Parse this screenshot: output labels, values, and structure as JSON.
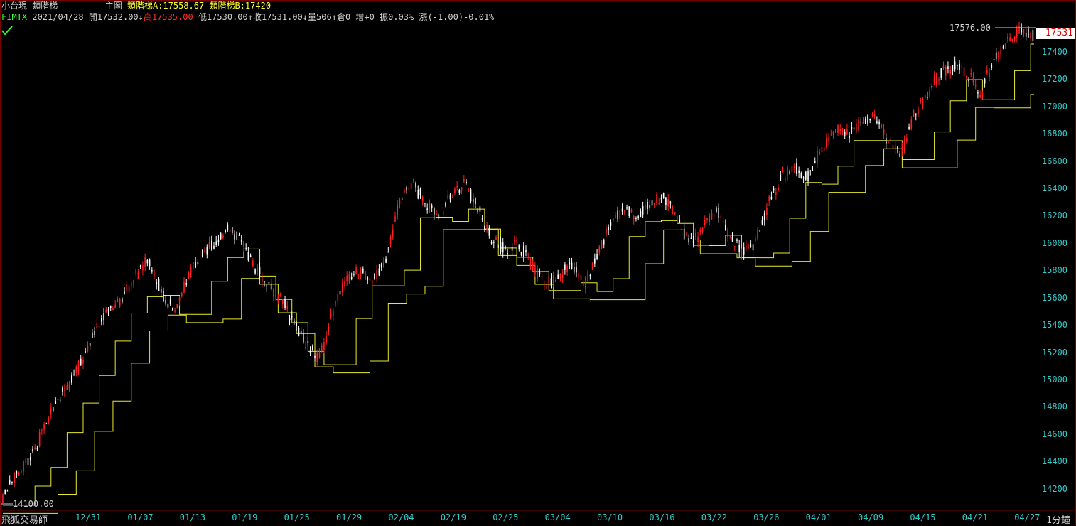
{
  "header": {
    "instrument_name": "小台現",
    "indicator_name": "類階梯",
    "main_chart_label": "主圖",
    "ladder_a": "類階梯A:17558.67",
    "ladder_b": "類階梯B:17420"
  },
  "quote": {
    "symbol": "FIMTX",
    "date": "2021/04/28",
    "open": "開17532.00",
    "high_arrow": "↓",
    "high": "高17535.00",
    "low": "低17530.00",
    "close_arrow": "↑",
    "close": "收17531.00",
    "volume_arrow": "↓",
    "volume": "量506",
    "oi_arrow": "↑",
    "open_interest": "倉0",
    "oi_change": "增+0",
    "amplitude": "振0.03%",
    "change": "漲(-1.00)-0.01%"
  },
  "chart_labels": {
    "high_marker": "17576.00",
    "low_marker": "14100.00",
    "last_price": "17531"
  },
  "y_axis": [
    "17400",
    "17200",
    "17000",
    "16800",
    "16600",
    "16400",
    "16200",
    "16000",
    "15800",
    "15600",
    "15400",
    "15200",
    "15000",
    "14800",
    "14600",
    "14400",
    "14200"
  ],
  "x_axis": [
    "12/31",
    "01/07",
    "01/13",
    "01/19",
    "01/25",
    "01/29",
    "02/04",
    "02/19",
    "02/25",
    "03/04",
    "03/10",
    "03/16",
    "03/22",
    "03/26",
    "04/01",
    "04/09",
    "04/15",
    "04/21",
    "04/27"
  ],
  "footer": {
    "brand": "飛狐交易師",
    "period": "1分鐘"
  },
  "colors": {
    "background": "#000000",
    "candle_up": "#ff2020",
    "candle_down": "#ffffff",
    "ladder_line": "#e8e830",
    "axis_text": "#33cccc",
    "frame": "#7a0000"
  },
  "chart_data": {
    "type": "candlestick",
    "ylim": [
      14100,
      17576
    ],
    "price_path": [
      {
        "x": "12/31",
        "v": 14150
      },
      {
        "v": 14300
      },
      {
        "v": 14420
      },
      {
        "v": 14600
      },
      {
        "v": 14850
      },
      {
        "v": 14950
      },
      {
        "x": "01/07",
        "v": 15150
      },
      {
        "v": 15350
      },
      {
        "v": 15500
      },
      {
        "v": 15600
      },
      {
        "v": 15750
      },
      {
        "v": 15900
      },
      {
        "x": "01/13",
        "v": 15650
      },
      {
        "v": 15500
      },
      {
        "v": 15750
      },
      {
        "v": 15900
      },
      {
        "v": 16000
      },
      {
        "v": 16100
      },
      {
        "x": "01/19",
        "v": 16050
      },
      {
        "v": 15850
      },
      {
        "v": 15700
      },
      {
        "v": 15600
      },
      {
        "v": 15450
      },
      {
        "v": 15250
      },
      {
        "x": "01/29",
        "v": 15150
      },
      {
        "v": 15500
      },
      {
        "v": 15750
      },
      {
        "v": 15800
      },
      {
        "v": 15750
      },
      {
        "v": 15850
      },
      {
        "x": "02/04",
        "v": 16300
      },
      {
        "v": 16450
      },
      {
        "v": 16300
      },
      {
        "v": 16200
      },
      {
        "v": 16350
      },
      {
        "v": 16450
      },
      {
        "x": "02/19",
        "v": 16250
      },
      {
        "v": 16050
      },
      {
        "v": 15950
      },
      {
        "v": 16000
      },
      {
        "v": 15850
      },
      {
        "v": 15700
      },
      {
        "x": "03/04",
        "v": 15750
      },
      {
        "v": 15850
      },
      {
        "v": 15700
      },
      {
        "v": 15900
      },
      {
        "v": 16150
      },
      {
        "v": 16250
      },
      {
        "x": "03/10",
        "v": 16200
      },
      {
        "v": 16300
      },
      {
        "v": 16350
      },
      {
        "v": 16200
      },
      {
        "v": 16000
      },
      {
        "v": 16100
      },
      {
        "x": "03/16",
        "v": 16250
      },
      {
        "v": 16050
      },
      {
        "v": 15950
      },
      {
        "v": 16000
      },
      {
        "v": 16300
      },
      {
        "v": 16500
      },
      {
        "x": "03/26",
        "v": 16550
      },
      {
        "v": 16500
      },
      {
        "v": 16700
      },
      {
        "v": 16850
      },
      {
        "v": 16800
      },
      {
        "v": 16900
      },
      {
        "x": "04/09",
        "v": 16950
      },
      {
        "v": 16750
      },
      {
        "v": 16650
      },
      {
        "v": 16950
      },
      {
        "v": 17100
      },
      {
        "v": 17250
      },
      {
        "x": "04/15",
        "v": 17300
      },
      {
        "v": 17250
      },
      {
        "v": 17100
      },
      {
        "v": 17350
      },
      {
        "v": 17500
      },
      {
        "v": 17560
      },
      {
        "x": "04/27",
        "v": 17531
      }
    ]
  }
}
